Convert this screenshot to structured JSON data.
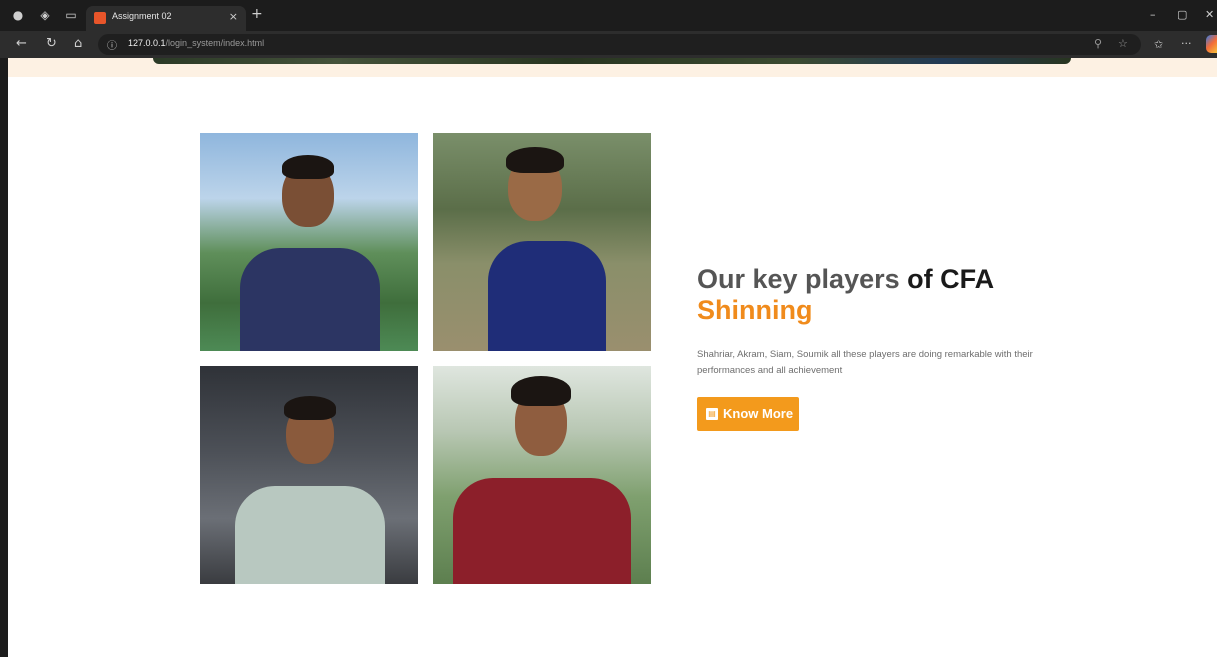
{
  "browser": {
    "tab_title": "Assignment 02",
    "tab_close": "×",
    "new_tab": "+",
    "url_host": "127.0.0.1",
    "url_path": "/login_system/index.html",
    "icons": [
      "profile-icon",
      "workspaces-icon",
      "tab-actions-icon",
      "back-icon",
      "reload-icon",
      "home-icon",
      "site-info-icon",
      "read-aloud-icon",
      "favorite-icon",
      "collections-icon",
      "more-icon",
      "copilot-icon"
    ],
    "window_controls": [
      "–",
      "▢",
      "✕"
    ]
  },
  "section": {
    "title_light": "Our key players ",
    "title_bold": "of CFA",
    "title_accent": "Shinning",
    "description": "Shahriar, Akram, Siam, Soumik all these players are doing remarkable with their performances and all achievement",
    "button_label": "Know More",
    "accent_color": "#f08b1c",
    "button_color": "#f39a1c",
    "players": [
      "player-photo",
      "player-photo",
      "player-photo",
      "player-photo"
    ]
  }
}
